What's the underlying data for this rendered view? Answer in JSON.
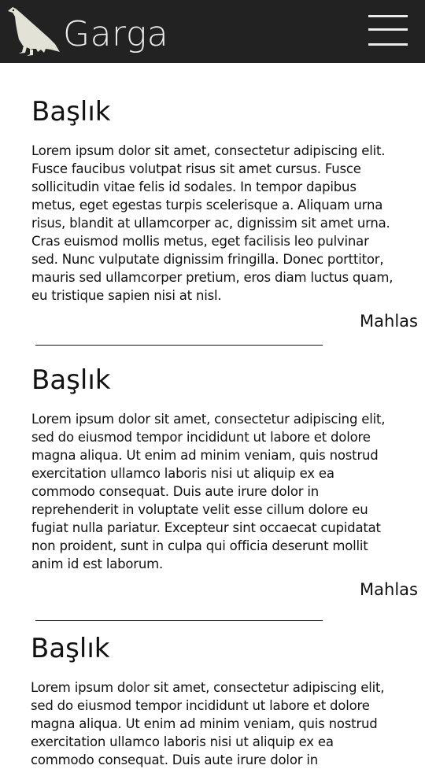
{
  "header": {
    "brand": "Garga",
    "logo_icon": "crow-icon",
    "menu_icon": "hamburger-menu-icon",
    "background": "#222222",
    "foreground": "#ececec"
  },
  "articles": [
    {
      "title": "Başlık",
      "body": "Lorem ipsum dolor sit amet, consectetur adipiscing elit. Fusce faucibus volutpat risus sit amet cursus. Fusce sollicitudin vitae felis id sodales. In tempor dapibus metus, eget egestas turpis scelerisque a. Aliquam urna risus, blandit at ullamcorper ac, dignissim sit amet urna. Cras euismod mollis metus, eget facilisis leo pulvinar sed. Nunc vulputate dignissim fringilla. Donec porttitor, mauris sed ullamcorper pretium, eros diam luctus quam, eu tristique sapien nisi at nisl.",
      "more": "Mahlas"
    },
    {
      "title": "Başlık",
      "body": "Lorem ipsum dolor sit amet, consectetur adipiscing elit, sed do eiusmod tempor incididunt ut labore et dolore magna aliqua. Ut enim ad minim veniam, quis nostrud exercitation ullamco laboris nisi ut aliquip ex ea commodo consequat. Duis aute irure dolor in reprehenderit in voluptate velit esse cillum dolore eu fugiat nulla pariatur. Excepteur sint occaecat cupidatat non proident, sunt in culpa qui officia deserunt mollit anim id est laborum.",
      "more": "Mahlas"
    },
    {
      "title": "Başlık",
      "body": "Lorem ipsum dolor sit amet, consectetur adipiscing elit, sed do eiusmod tempor incididunt ut labore et dolore magna aliqua. Ut enim ad minim veniam, quis nostrud exercitation ullamco laboris nisi ut aliquip ex ea commodo consequat. Duis aute irure dolor in"
    }
  ]
}
